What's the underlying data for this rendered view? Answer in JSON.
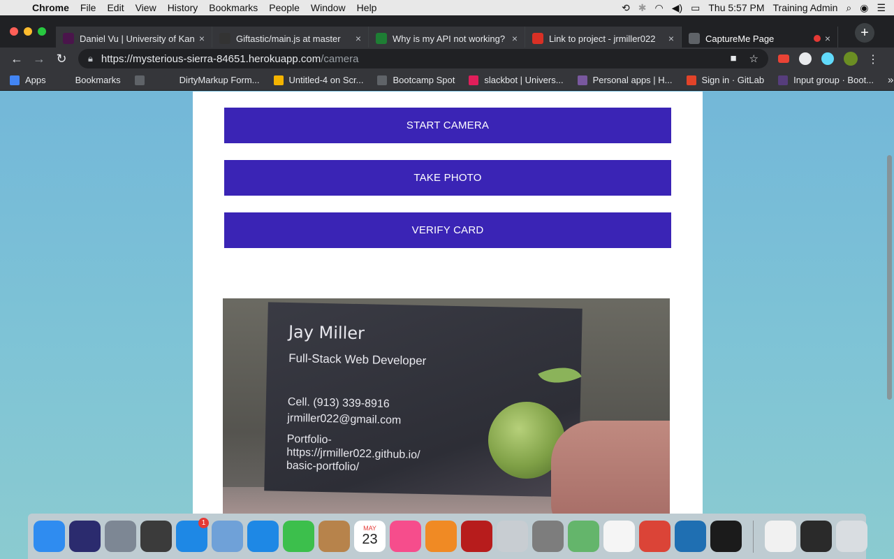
{
  "menubar": {
    "app": "Chrome",
    "items": [
      "File",
      "Edit",
      "View",
      "History",
      "Bookmarks",
      "People",
      "Window",
      "Help"
    ],
    "clock": "Thu 5:57 PM",
    "user": "Training Admin"
  },
  "tabs": [
    {
      "title": "Daniel Vu | University of Kan",
      "icon": "slack-icon",
      "color": "#4a154b"
    },
    {
      "title": "Giftastic/main.js at master",
      "icon": "github-icon",
      "color": "#333333"
    },
    {
      "title": "Why is my API not working?",
      "icon": "bootcamp-icon",
      "color": "#1e7e34"
    },
    {
      "title": "Link to project - jrmiller022",
      "icon": "gmail-icon",
      "color": "#d93025"
    },
    {
      "title": "CaptureMe Page",
      "icon": "page-icon",
      "color": "#5f6368"
    }
  ],
  "address_bar": {
    "url_host": "https://mysterious-sierra-84651.herokuapp.com",
    "url_path": "/camera"
  },
  "bookmarks": [
    {
      "label": "Apps",
      "icon": "apps-grid-icon",
      "color": "#4285f4"
    },
    {
      "label": "Bookmarks",
      "icon": "star-icon",
      "color": "#35363a"
    },
    {
      "label": "",
      "icon": "bookmark-icon",
      "color": "#5f6368"
    },
    {
      "label": "DirtyMarkup Form...",
      "icon": "code-icon",
      "color": "#35363a"
    },
    {
      "label": "Untitled-4 on Scr...",
      "icon": "scrimba-icon",
      "color": "#f4b400"
    },
    {
      "label": "Bootcamp Spot",
      "icon": "globe-icon",
      "color": "#5f6368"
    },
    {
      "label": "slackbot | Univers...",
      "icon": "slack-icon",
      "color": "#e01e5a"
    },
    {
      "label": "Personal apps | H...",
      "icon": "heroku-icon",
      "color": "#79589f"
    },
    {
      "label": "Sign in · GitLab",
      "icon": "gitlab-icon",
      "color": "#e24329"
    },
    {
      "label": "Input group · Boot...",
      "icon": "bootstrap-icon",
      "color": "#563d7c"
    }
  ],
  "page": {
    "buttons": {
      "start": "START CAMERA",
      "take": "TAKE PHOTO",
      "verify": "VERIFY CARD"
    },
    "card": {
      "name": "Jay Miller",
      "role": "Full-Stack Web Developer",
      "phone": "Cell. (913) 339-8916",
      "email": "jrmiller022@gmail.com",
      "portfolio_label": "Portfolio-",
      "portfolio_url1": "https://jrmiller022.github.io/",
      "portfolio_url2": "basic-portfolio/"
    }
  },
  "dock": [
    {
      "name": "finder-icon",
      "color": "#2f8cf0"
    },
    {
      "name": "siri-icon",
      "color": "#2b2b6e"
    },
    {
      "name": "launchpad-icon",
      "color": "#7d8794"
    },
    {
      "name": "dashboard-icon",
      "color": "#3b3b3b"
    },
    {
      "name": "app-store-icon",
      "color": "#1e88e5",
      "badge": "1"
    },
    {
      "name": "mail-icon",
      "color": "#6fa1d8"
    },
    {
      "name": "safari-icon",
      "color": "#1e88e5"
    },
    {
      "name": "facetime-icon",
      "color": "#3cbf4c"
    },
    {
      "name": "contacts-icon",
      "color": "#b7834b"
    },
    {
      "name": "calendar-icon",
      "color": "#ffffff"
    },
    {
      "name": "itunes-icon",
      "color": "#f64d8c"
    },
    {
      "name": "ibooks-icon",
      "color": "#f08a24"
    },
    {
      "name": "photo-booth-icon",
      "color": "#b71c1c"
    },
    {
      "name": "help-icon",
      "color": "#c8cdd2"
    },
    {
      "name": "system-preferences-icon",
      "color": "#7d7d7d"
    },
    {
      "name": "maps-icon",
      "color": "#64b56b"
    },
    {
      "name": "photos-icon",
      "color": "#f5f5f5"
    },
    {
      "name": "chrome-icon",
      "color": "#db4437"
    },
    {
      "name": "vscode-icon",
      "color": "#1f6fb2"
    },
    {
      "name": "terminal-icon",
      "color": "#1b1b1b"
    },
    {
      "name": "document-icon",
      "color": "#f1f1f1"
    },
    {
      "name": "screenshot-icon",
      "color": "#2a2a2a"
    },
    {
      "name": "trash-icon",
      "color": "#d9dde1"
    }
  ],
  "calendar": {
    "month": "MAY",
    "day": "23"
  }
}
